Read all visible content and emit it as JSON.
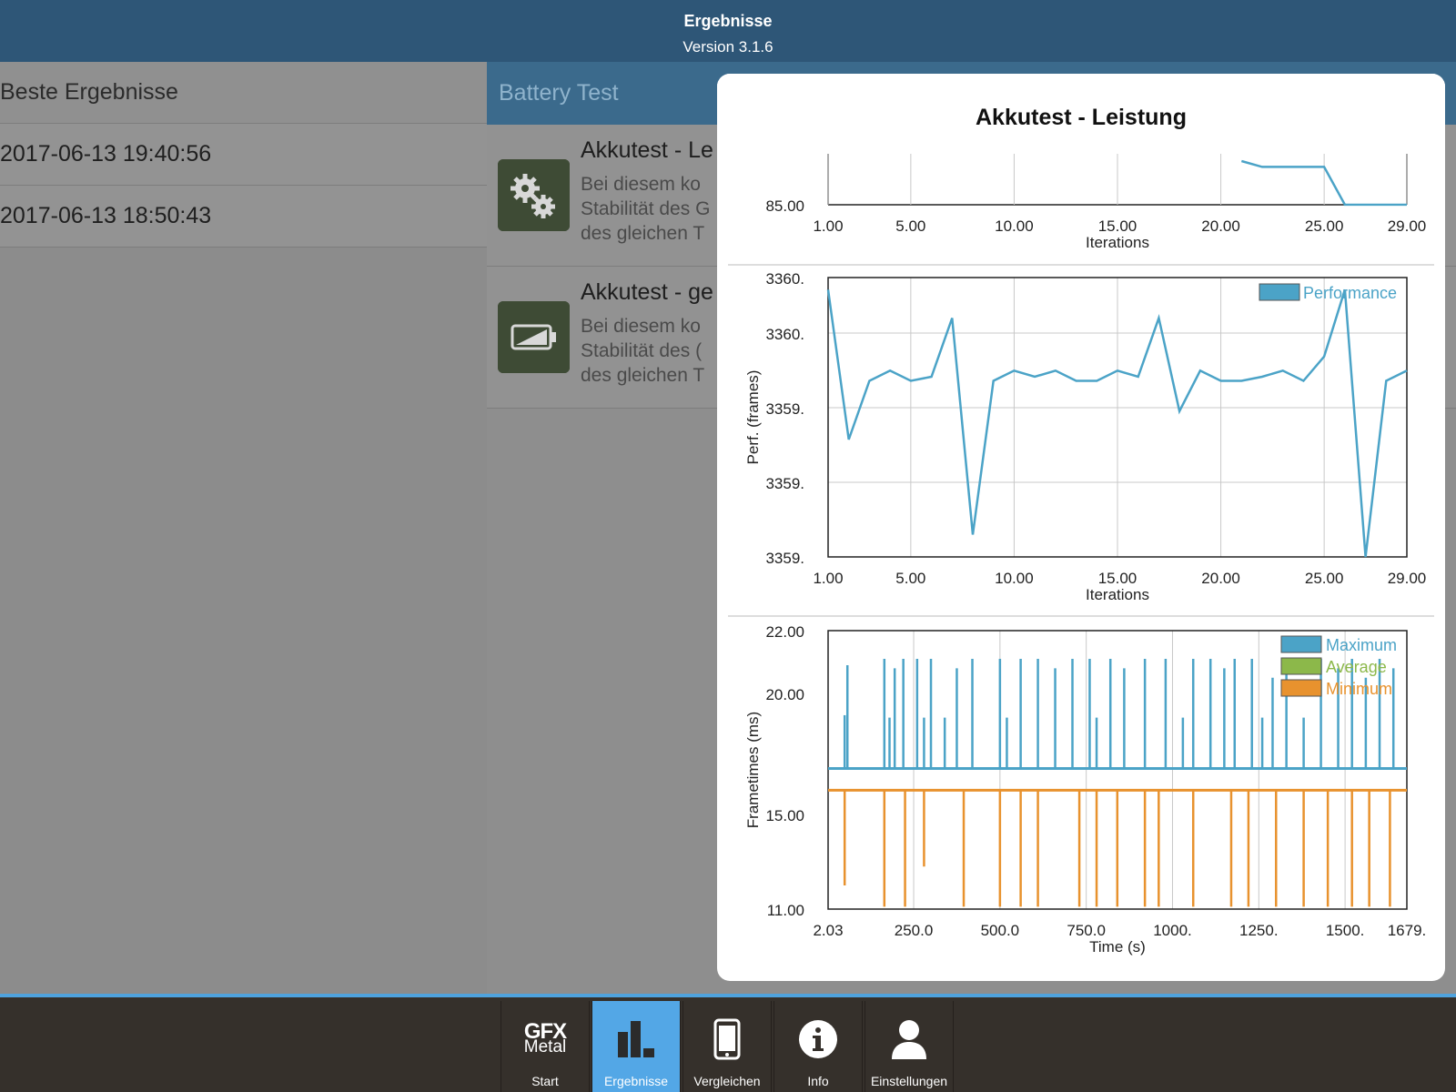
{
  "topbar": {
    "title": "Ergebnisse",
    "version": "Version 3.1.6"
  },
  "left": {
    "header": "Beste Ergebnisse",
    "rows": [
      "2017-06-13 19:40:56",
      "2017-06-13 18:50:43"
    ]
  },
  "middle": {
    "header": "Battery Test",
    "items": [
      {
        "title": "Akkutest - Le",
        "desc": "Bei diesem ko\nStabilität des G\ndes gleichen T",
        "icon": "gears-icon"
      },
      {
        "title": "Akkutest - ge",
        "desc": "Bei diesem ko\nStabilität des (\ndes gleichen T",
        "icon": "battery-icon"
      }
    ]
  },
  "modal": {
    "title": "Akkutest - Leistung"
  },
  "chart_data": [
    {
      "type": "line",
      "note": "partially visible (scrolled) chart",
      "xlabel": "Iterations",
      "ylabel": "",
      "x_ticks": [
        "1.00",
        "5.00",
        "10.00",
        "15.00",
        "20.00",
        "25.00",
        "29.00"
      ],
      "y_ticks": [
        "85.00"
      ],
      "x": [
        21,
        22,
        23,
        24,
        25,
        26,
        27,
        28,
        29
      ],
      "y": [
        86.5,
        86.3,
        86.3,
        86.3,
        86.3,
        85.0,
        85.0,
        85.0,
        85.0
      ],
      "ylim": [
        85.0,
        87.0
      ],
      "xlim": [
        1,
        29
      ],
      "color": "#4ba3c7"
    },
    {
      "type": "line",
      "xlabel": "Iterations",
      "ylabel": "Perf. (frames)",
      "x_ticks": [
        "1.00",
        "5.00",
        "10.00",
        "15.00",
        "20.00",
        "25.00",
        "29.00"
      ],
      "y_ticks": [
        "3360.",
        "3360.",
        "3359.",
        "3359.",
        "3359."
      ],
      "legend": [
        "Performance"
      ],
      "xlim": [
        1,
        29
      ],
      "ylim": [
        3358.88,
        3360.26
      ],
      "series": [
        {
          "name": "Performance",
          "color": "#4ba3c7",
          "x": [
            1,
            2,
            3,
            4,
            5,
            6,
            7,
            8,
            9,
            10,
            11,
            12,
            13,
            14,
            15,
            16,
            17,
            18,
            19,
            20,
            21,
            22,
            23,
            24,
            25,
            26,
            27,
            28,
            29
          ],
          "values": [
            3360.2,
            3359.46,
            3359.75,
            3359.8,
            3359.75,
            3359.77,
            3360.06,
            3358.99,
            3359.75,
            3359.8,
            3359.77,
            3359.8,
            3359.75,
            3359.75,
            3359.8,
            3359.77,
            3360.06,
            3359.6,
            3359.8,
            3359.75,
            3359.75,
            3359.77,
            3359.8,
            3359.75,
            3359.87,
            3360.2,
            3358.88,
            3359.75,
            3359.8
          ]
        }
      ]
    },
    {
      "type": "bar",
      "xlabel": "Time (s)",
      "ylabel": "Frametimes (ms)",
      "x_ticks": [
        "2.03",
        "250.0",
        "500.0",
        "750.0",
        "1000.",
        "1250.",
        "1500.",
        "1679."
      ],
      "y_ticks": [
        "22.00",
        "20.00",
        "15.00",
        "11.00"
      ],
      "legend": [
        "Maximum",
        "Average",
        "Minimum"
      ],
      "xlim": [
        2.03,
        1679
      ],
      "ylim": [
        11,
        22
      ],
      "series": [
        {
          "name": "Maximum",
          "color": "#4ba3c7",
          "baseline": 16.9,
          "spikes": [
            [
              50,
              19.1
            ],
            [
              58,
              20.9
            ],
            [
              165,
              21.1
            ],
            [
              180,
              19.0
            ],
            [
              195,
              20.8
            ],
            [
              220,
              21.1
            ],
            [
              260,
              21.1
            ],
            [
              280,
              19.0
            ],
            [
              300,
              21.1
            ],
            [
              340,
              19.0
            ],
            [
              375,
              20.8
            ],
            [
              420,
              21.1
            ],
            [
              500,
              21.1
            ],
            [
              520,
              19.0
            ],
            [
              560,
              21.1
            ],
            [
              610,
              21.1
            ],
            [
              660,
              20.8
            ],
            [
              710,
              21.1
            ],
            [
              760,
              21.1
            ],
            [
              780,
              19.0
            ],
            [
              820,
              21.1
            ],
            [
              860,
              20.8
            ],
            [
              920,
              21.1
            ],
            [
              980,
              21.1
            ],
            [
              1030,
              19.0
            ],
            [
              1060,
              21.1
            ],
            [
              1110,
              21.1
            ],
            [
              1150,
              20.8
            ],
            [
              1180,
              21.1
            ],
            [
              1230,
              21.1
            ],
            [
              1260,
              19.0
            ],
            [
              1290,
              20.5
            ],
            [
              1330,
              21.1
            ],
            [
              1380,
              19.0
            ],
            [
              1430,
              21.1
            ],
            [
              1480,
              20.8
            ],
            [
              1520,
              21.1
            ],
            [
              1560,
              20.5
            ],
            [
              1600,
              21.1
            ],
            [
              1640,
              20.8
            ]
          ]
        },
        {
          "name": "Average",
          "color": "#8cb84a"
        },
        {
          "name": "Minimum",
          "color": "#e8922e",
          "baseline": 16.0,
          "dips": [
            [
              50,
              12.0
            ],
            [
              165,
              11.1
            ],
            [
              225,
              11.1
            ],
            [
              280,
              12.8
            ],
            [
              395,
              11.1
            ],
            [
              500,
              11.1
            ],
            [
              560,
              11.1
            ],
            [
              610,
              11.1
            ],
            [
              730,
              11.1
            ],
            [
              780,
              11.1
            ],
            [
              840,
              11.1
            ],
            [
              920,
              11.1
            ],
            [
              960,
              11.1
            ],
            [
              1060,
              11.1
            ],
            [
              1170,
              11.1
            ],
            [
              1220,
              11.1
            ],
            [
              1300,
              11.1
            ],
            [
              1380,
              11.1
            ],
            [
              1450,
              11.1
            ],
            [
              1520,
              11.1
            ],
            [
              1570,
              11.1
            ],
            [
              1630,
              11.1
            ]
          ]
        }
      ]
    }
  ],
  "tabs": [
    {
      "label": "Start",
      "icon": "gfx-metal-logo-icon",
      "logo_line1": "GFX",
      "logo_line2": "Metal",
      "active": false
    },
    {
      "label": "Ergebnisse",
      "icon": "bar-chart-icon",
      "active": true
    },
    {
      "label": "Vergleichen",
      "icon": "phone-icon",
      "active": false
    },
    {
      "label": "Info",
      "icon": "info-icon",
      "active": false
    },
    {
      "label": "Einstellungen",
      "icon": "person-icon",
      "active": false
    }
  ]
}
